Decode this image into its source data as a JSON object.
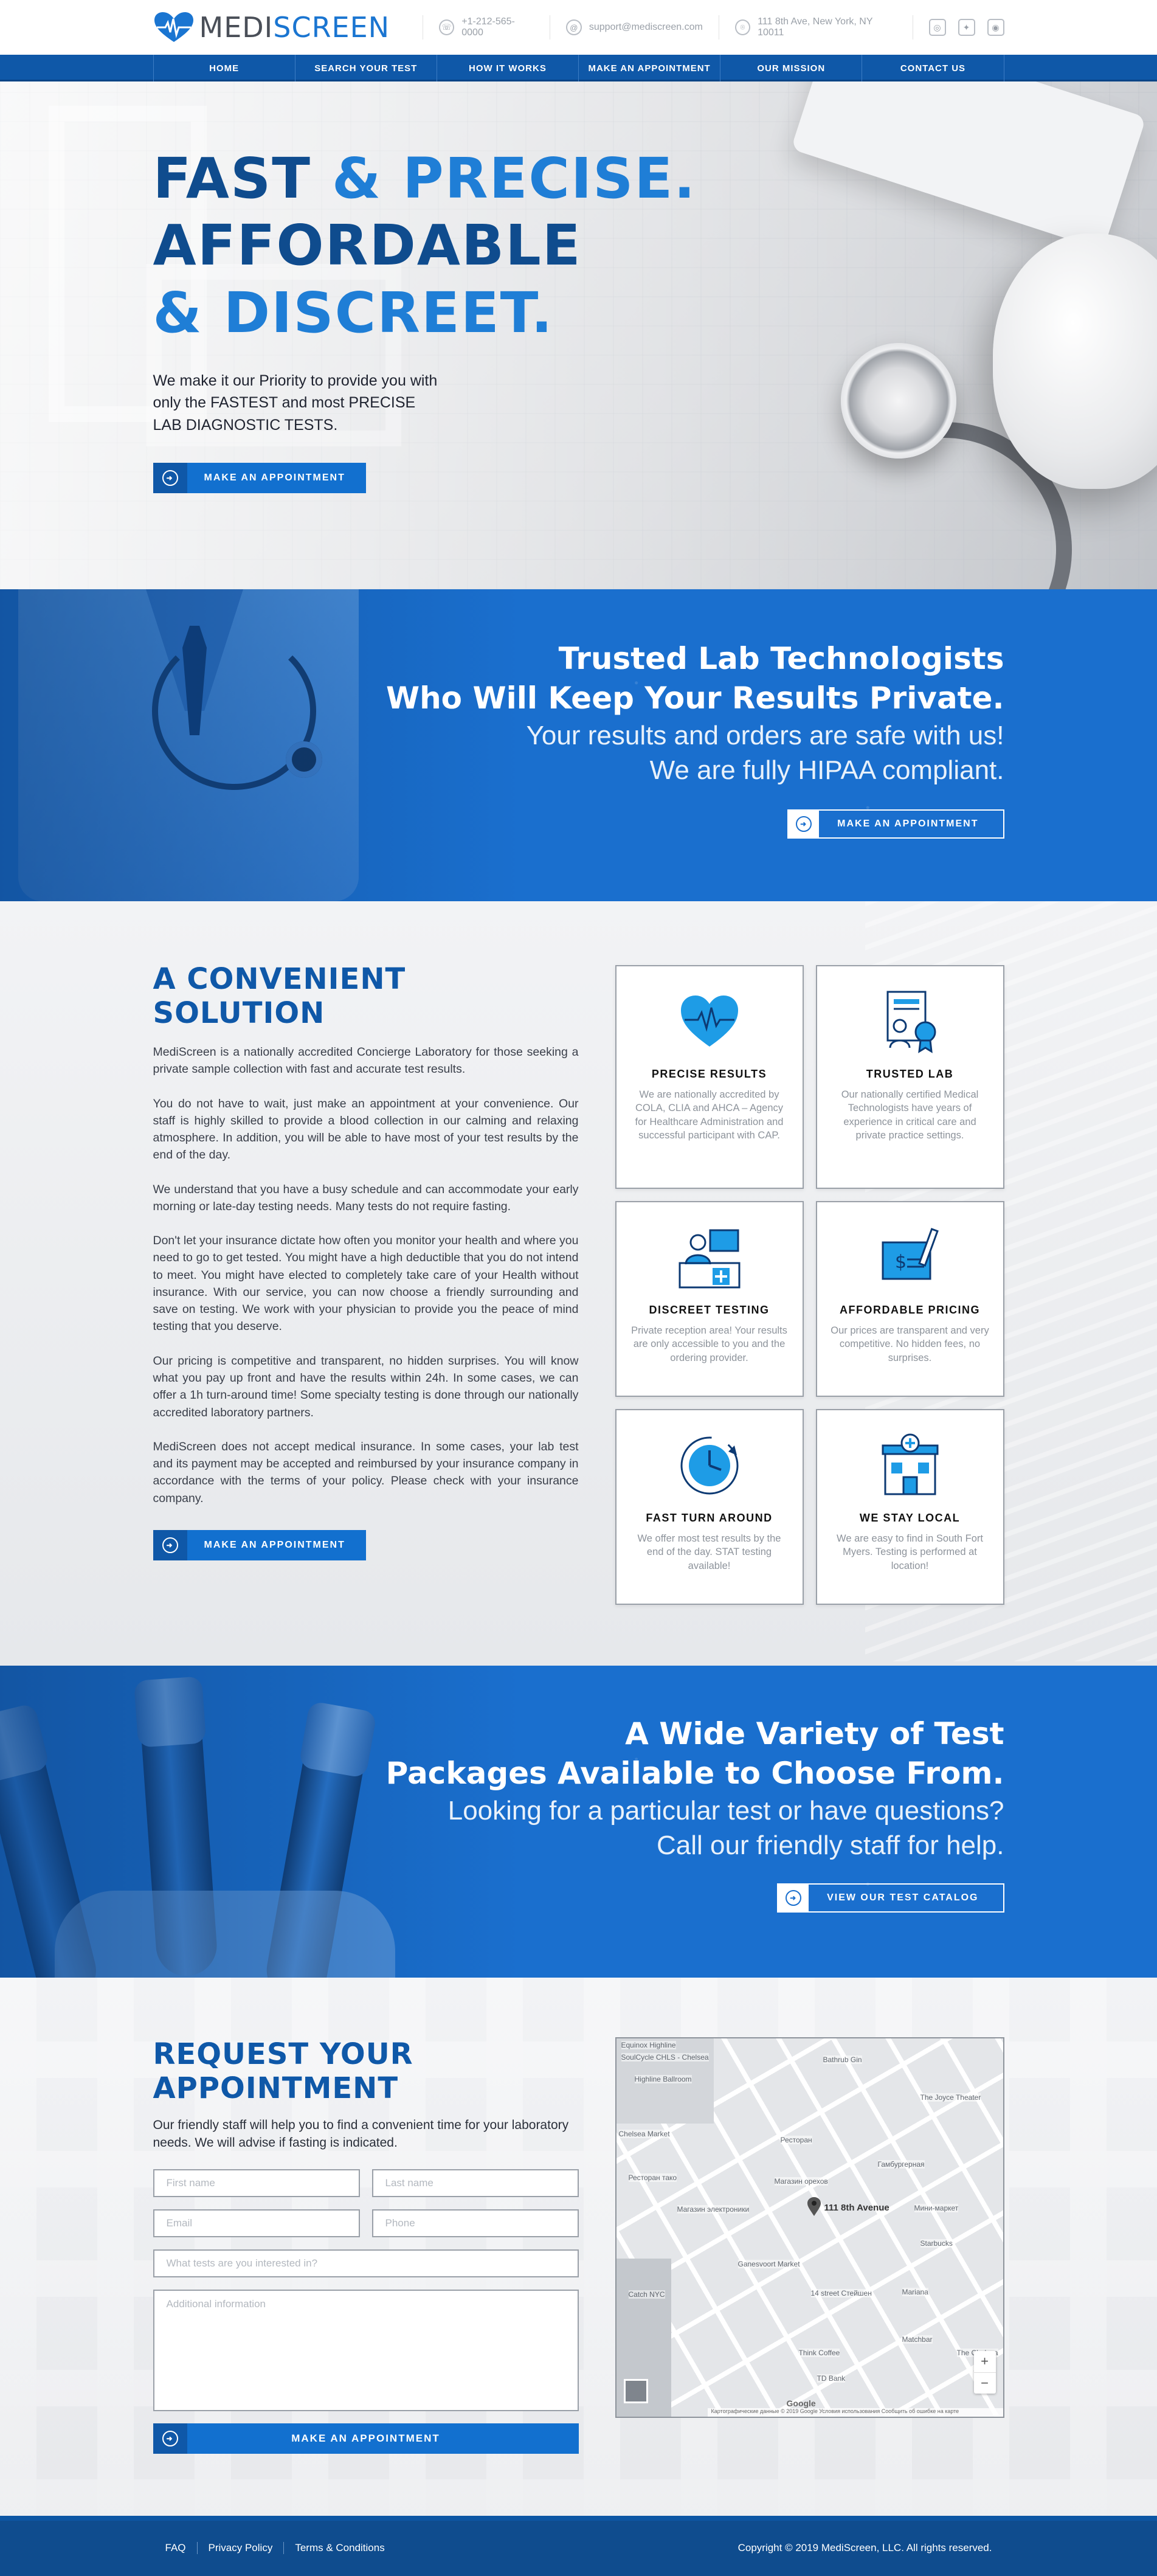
{
  "brand": {
    "name_part1": "MEDI",
    "name_part2": "SCREEN",
    "accent": "#1a75d1",
    "dark_blue": "#0f58a8"
  },
  "header": {
    "phone": "+1-212-565-0000",
    "email": "support@mediscreen.com",
    "address": "111 8th Ave, New York, NY 10011",
    "social_icons": [
      "instagram-icon",
      "twitter-icon",
      "instagram-camera-icon"
    ]
  },
  "nav": [
    "HOME",
    "SEARCH YOUR TEST",
    "HOW IT WORKS",
    "MAKE AN APPOINTMENT",
    "OUR MISSION",
    "CONTACT US"
  ],
  "hero": {
    "line1_a": "FAST",
    "line1_b": "& PRECISE.",
    "line2": "AFFORDABLE",
    "line3": "& DISCREET.",
    "text_1": "We make it our Priority to provide you with",
    "text_2": "only the FASTEST and most PRECISE",
    "text_3": "LAB DIAGNOSTIC TESTS.",
    "button": "MAKE AN APPOINTMENT"
  },
  "trusted": {
    "title_1": "Trusted Lab Technologists",
    "title_2": "Who Will Keep Your Results Private.",
    "sub_1": "Your results and orders are safe with us!",
    "sub_2": "We are fully HIPAA compliant.",
    "button": "MAKE AN APPOINTMENT"
  },
  "convenient": {
    "title": "A CONVENIENT SOLUTION",
    "paragraphs": [
      "MediScreen is a nationally accredited Concierge Laboratory for those seeking a private sample collection with fast and accurate test results.",
      "You do not have to wait, just make an appointment at your convenience. Our staff is highly skilled to provide a blood collection in our calming and relaxing atmosphere. In addition, you will be able to have most of your test results by the end of the day.",
      "We understand that you have a busy schedule and can accommodate your early morning or late-day testing needs. Many tests do not require fasting.",
      "Don't let your insurance dictate how often you monitor your health and where you need to go to get tested. You might have a high deductible that you do not intend to meet. You might have elected to completely take care of your Health without insurance. With our service, you can now choose a friendly surrounding and save on testing. We work with your physician to provide you the peace of mind testing that you deserve.",
      "Our pricing is competitive and transparent, no hidden surprises. You will know what you pay up front and have the results within 24h. In some cases, we can offer a 1h turn-around time! Some specialty testing is done through our nationally accredited laboratory partners.",
      "MediScreen does not accept medical insurance. In some cases, your lab test and its payment may be accepted and reimbursed by your insurance company in accordance with the terms of your policy. Please check with your insurance company."
    ],
    "button": "MAKE AN APPOINTMENT",
    "cards": [
      {
        "title": "PRECISE RESULTS",
        "text": "We are nationally accredited by COLA, CLIA and AHCA – Agency for Healthcare Administration and successful participant with CAP.",
        "icon": "heart-pulse-icon"
      },
      {
        "title": "TRUSTED LAB",
        "text": "Our nationally certified Medical Technologists have years of experience in critical care and private practice settings.",
        "icon": "certificate-icon"
      },
      {
        "title": "DISCREET TESTING",
        "text": "Private reception area! Your results are only accessible to you and the ordering provider.",
        "icon": "reception-icon"
      },
      {
        "title": "AFFORDABLE PRICING",
        "text": "Our prices are transparent and very competitive. No hidden fees, no surprises.",
        "icon": "invoice-icon"
      },
      {
        "title": "FAST TURN AROUND",
        "text": "We offer most test results by the end of the day. STAT testing available!",
        "icon": "clock-icon"
      },
      {
        "title": "WE STAY LOCAL",
        "text": "We are easy to find in South Fort Myers. Testing is performed at location!",
        "icon": "clinic-icon"
      }
    ]
  },
  "packages": {
    "title_1": "A Wide Variety of Test",
    "title_2": "Packages Available to Choose From.",
    "sub_1": "Looking for a particular test or have questions?",
    "sub_2": "Call our friendly staff for help.",
    "button": "VIEW OUR TEST CATALOG"
  },
  "appointment": {
    "title": "REQUEST YOUR APPOINTMENT",
    "lead": "Our friendly staff will help you to find a convenient time for your laboratory needs. We will advise if fasting is indicated.",
    "ph_first": "First name",
    "ph_last": "Last name",
    "ph_email": "Email",
    "ph_phone": "Phone",
    "ph_tests": "What tests are you interested in?",
    "ph_info": "Additional information",
    "submit": "MAKE AN APPOINTMENT"
  },
  "map": {
    "marker": "111 8th Avenue",
    "labels": [
      "Equinox Highline",
      "SoulCycle CHLS - Chelsea",
      "Highline Ballroom",
      "Bathrub Gin",
      "The Joyce Theater",
      "Chelsea Market",
      "Ресторан",
      "Гамбургерная",
      "Магазин орехов",
      "Ресторан тако",
      "Магазин электроники",
      "Мини-маркет",
      "Starbucks",
      "Ganesvoort Market",
      "14 street Стейшен",
      "Catch NYC",
      "Mariana",
      "Think Coffee",
      "TD Bank",
      "The Chelsea",
      "Matchbar",
      "Google"
    ],
    "attribution": "Картографические данные © 2019 Google   Условия использования   Сообщить об ошибке на карте"
  },
  "footer": {
    "links": [
      "FAQ",
      "Privacy Policy",
      "Terms & Conditions"
    ],
    "copyright": "Copyright © 2019 MediScreen, LLC. All rights reserved."
  }
}
